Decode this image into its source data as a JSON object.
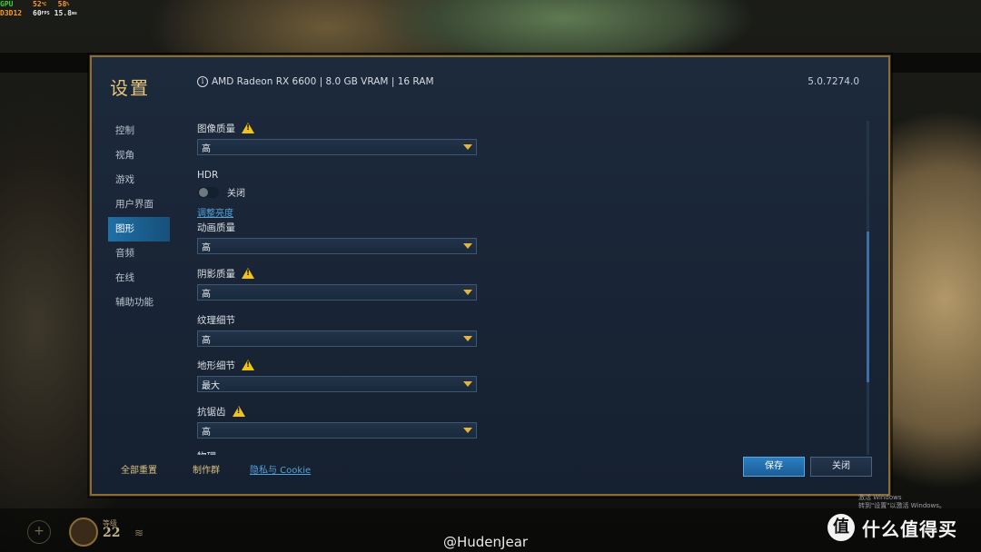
{
  "overlay": {
    "gpu_label": "GPU",
    "gpu_temp": "52",
    "gpu_temp_unit": "℃",
    "gpu_usage": "58",
    "gpu_usage_unit": "%",
    "api_label": "D3D12",
    "fps": "60",
    "fps_unit": "FPS",
    "frametime": "15.8",
    "frametime_unit": "ms"
  },
  "settings": {
    "title": "设置",
    "system_info": "AMD Radeon RX 6600 | 8.0 GB VRAM | 16 RAM",
    "version": "5.0.7274.0",
    "nav": [
      {
        "label": "控制",
        "active": false
      },
      {
        "label": "视角",
        "active": false
      },
      {
        "label": "游戏",
        "active": false
      },
      {
        "label": "用户界面",
        "active": false
      },
      {
        "label": "图形",
        "active": true
      },
      {
        "label": "音频",
        "active": false
      },
      {
        "label": "在线",
        "active": false
      },
      {
        "label": "辅助功能",
        "active": false
      }
    ],
    "image_quality": {
      "label": "图像质量",
      "value": "高"
    },
    "hdr": {
      "label": "HDR",
      "state": "关闭",
      "enabled": false,
      "link": "调整亮度"
    },
    "animation_quality": {
      "label": "动画质量",
      "value": "高"
    },
    "shadow_quality": {
      "label": "阴影质量",
      "value": "高"
    },
    "texture_detail": {
      "label": "纹理细节",
      "value": "高"
    },
    "terrain_detail": {
      "label": "地形细节",
      "value": "最大"
    },
    "antialiasing": {
      "label": "抗锯齿",
      "value": "高"
    },
    "physics": {
      "label": "物理"
    },
    "footer": {
      "reset_all": "全部重置",
      "credits": "制作群",
      "privacy": "隐私与 Cookie",
      "save": "保存",
      "close": "关闭"
    }
  },
  "system": {
    "activation_line1": "激活 Windows",
    "activation_line2": "转到\"设置\"以激活 Windows。"
  },
  "hud": {
    "level_label": "等级",
    "level_value": "22"
  },
  "watermark": "@HudenJear",
  "brand": {
    "icon": "值",
    "name": "什么值得买"
  },
  "colors": {
    "accent_gold": "#e6c57a",
    "active_blue": "#1f6fa6",
    "link_blue": "#4fa3d9",
    "warning_yellow": "#f0c419"
  }
}
